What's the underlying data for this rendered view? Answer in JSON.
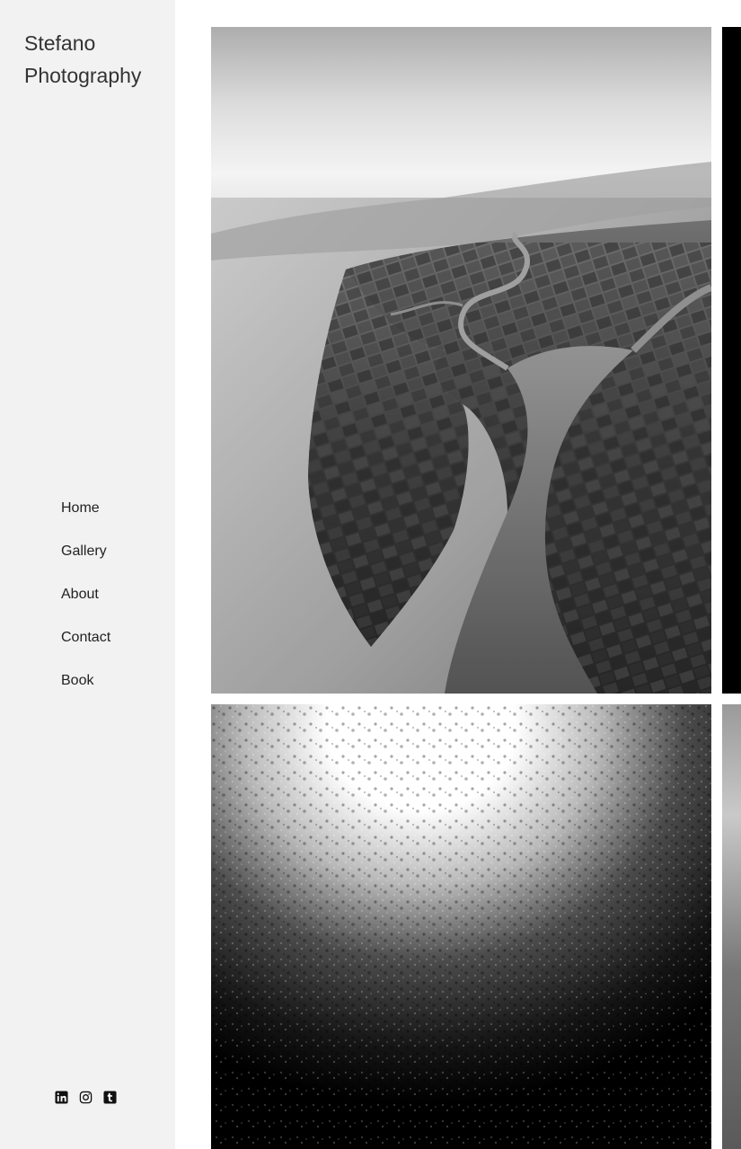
{
  "site": {
    "title_line1": "Stefano",
    "title_line2": "Photography"
  },
  "nav": {
    "items": [
      {
        "label": "Home"
      },
      {
        "label": "Gallery"
      },
      {
        "label": "About"
      },
      {
        "label": "Contact"
      },
      {
        "label": "Book"
      }
    ]
  },
  "social": {
    "icons": [
      "linkedin-icon",
      "instagram-icon",
      "tumblr-icon"
    ]
  },
  "gallery": {
    "photos": [
      {
        "subject": "aerial-coastline-black-and-white"
      },
      {
        "subject": "dark-panel"
      },
      {
        "subject": "backlit-water-surface-black-and-white"
      },
      {
        "subject": "grey-partial-photo"
      }
    ]
  },
  "colors": {
    "sidebar_bg": "#f2f2f2",
    "text": "#222222",
    "page_bg": "#ffffff"
  }
}
